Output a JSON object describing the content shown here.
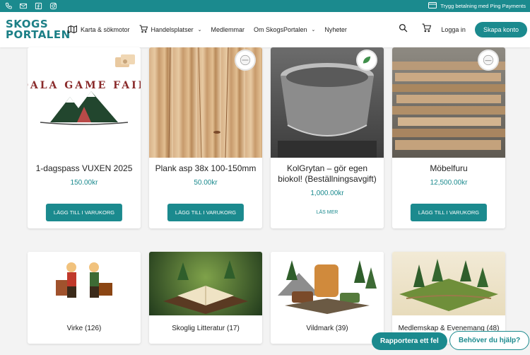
{
  "topbar": {
    "icons": [
      "phone-icon",
      "mail-icon",
      "facebook-icon",
      "instagram-icon"
    ],
    "payment_text": "Trygg betalning med Ping Payments"
  },
  "header": {
    "logo_line1": "SKOGS",
    "logo_line2": "PORTALEN",
    "nav": [
      {
        "label": "Karta & sökmotor",
        "icon": "map-icon"
      },
      {
        "label": "Handelsplatser",
        "icon": "cart-icon",
        "dropdown": true
      },
      {
        "label": "Medlemmar"
      },
      {
        "label": "Om SkogsPortalen",
        "dropdown": true
      },
      {
        "label": "Nyheter"
      }
    ],
    "login_label": "Logga in",
    "signup_label": "Skapa konto"
  },
  "products": [
    {
      "name": "1-dagspass VUXEN 2025",
      "price": "150.00kr",
      "action": "LÄGG TILL I VARUKORG",
      "logo_text": "DALA GAME FAIR"
    },
    {
      "name": "Plank asp 38x 100-150mm",
      "price": "50.00kr",
      "action": "LÄGG TILL I VARUKORG"
    },
    {
      "name": "KolGrytan – gör egen biokol! (Beställningsavgift)",
      "price": "1,000.00kr",
      "action": "LÄS MER"
    },
    {
      "name": "Möbelfuru",
      "price": "12,500.00kr",
      "action": "LÄGG TILL I VARUKORG"
    }
  ],
  "categories": [
    {
      "label": "Virke (126)"
    },
    {
      "label": "Skoglig Litteratur (17)"
    },
    {
      "label": "Vildmark (39)"
    },
    {
      "label": "Medlemskap & Evenemang (48)"
    }
  ],
  "floating": {
    "report_label": "Rapportera ett fel",
    "help_label": "Behöver du hjälp?"
  },
  "colors": {
    "accent": "#1b8a8e",
    "background": "#f3f3f3"
  }
}
